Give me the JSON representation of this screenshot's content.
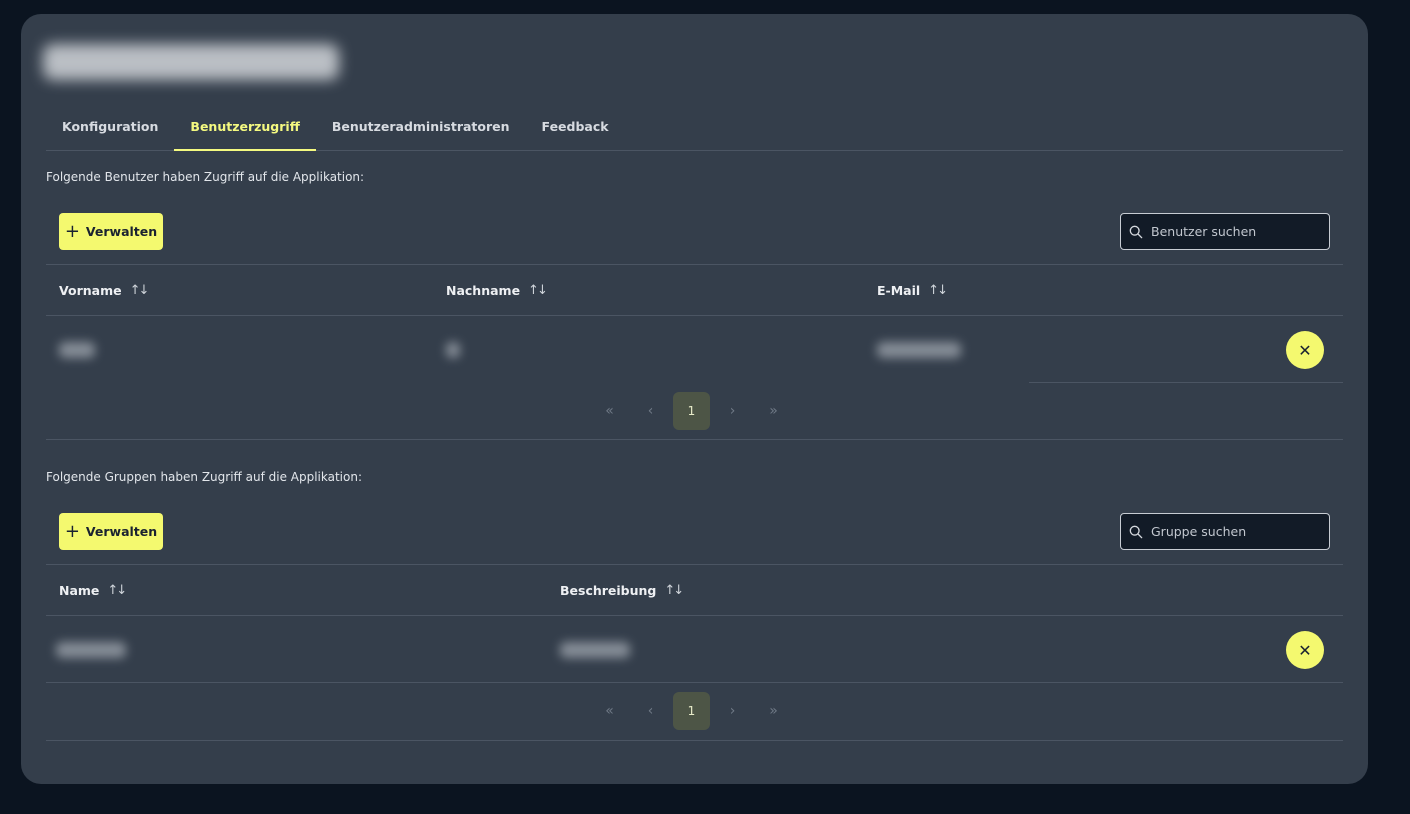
{
  "tabs": [
    {
      "label": "Konfiguration"
    },
    {
      "label": "Benutzerzugriff"
    },
    {
      "label": "Benutzeradministratoren"
    },
    {
      "label": "Feedback"
    }
  ],
  "active_tab": "Benutzerzugriff",
  "users_section": {
    "label": "Folgende Benutzer haben Zugriff auf die Applikation:",
    "manage_label": "Verwalten",
    "search_placeholder": "Benutzer suchen",
    "columns": [
      "Vorname",
      "Nachname",
      "E-Mail"
    ],
    "sort_icon": "↑↓",
    "pagination": {
      "first": "«",
      "prev": "‹",
      "current": "1",
      "next": "›",
      "last": "»"
    }
  },
  "groups_section": {
    "label": "Folgende Gruppen haben Zugriff auf die Applikation:",
    "manage_label": "Verwalten",
    "search_placeholder": "Gruppe suchen",
    "columns": [
      "Name",
      "Beschreibung"
    ],
    "sort_icon": "↑↓",
    "pagination": {
      "first": "«",
      "prev": "‹",
      "current": "1",
      "next": "›",
      "last": "»"
    }
  },
  "icons": {
    "plus": "+",
    "remove": "✕",
    "search": "search-icon"
  },
  "colors": {
    "background": "#0b1420",
    "panel": "#343e4b",
    "accent": "#f4f96f",
    "active_tab": "#f4f980"
  }
}
